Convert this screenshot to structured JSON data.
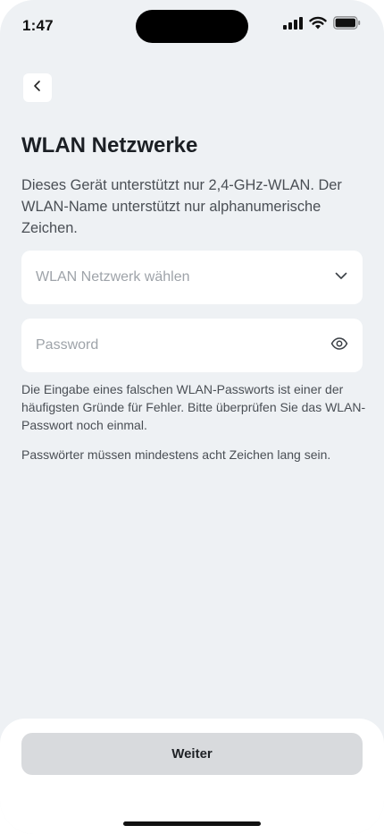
{
  "status_bar": {
    "time": "1:47",
    "icons": [
      "signal-icon",
      "wifi-icon",
      "battery-icon"
    ]
  },
  "nav": {
    "back_icon": "chevron-left-icon"
  },
  "page": {
    "title": "WLAN Netzwerke",
    "subtitle": "Dieses Gerät unterstützt nur 2,4-GHz-WLAN. Der WLAN-Name unterstützt nur alphanumerische Zeichen."
  },
  "form": {
    "network_placeholder": "WLAN Netzwerk wählen",
    "network_icon": "chevron-down-icon",
    "password_placeholder": "Password",
    "password_icon": "eye-icon",
    "hint_wrong_password": "Die Eingabe eines falschen WLAN-Passworts ist einer der häufigsten Gründe für Fehler. Bitte überprüfen Sie das WLAN-Passwort noch einmal.",
    "hint_length": "Passwörter müssen mindestens acht Zeichen lang sein."
  },
  "footer": {
    "continue_label": "Weiter"
  },
  "colors": {
    "background": "#eef1f4",
    "card": "#ffffff",
    "button_disabled": "#d8dadd",
    "text_primary": "#1b1f24",
    "text_secondary": "#4a4f55",
    "placeholder": "#9ea3a9"
  }
}
